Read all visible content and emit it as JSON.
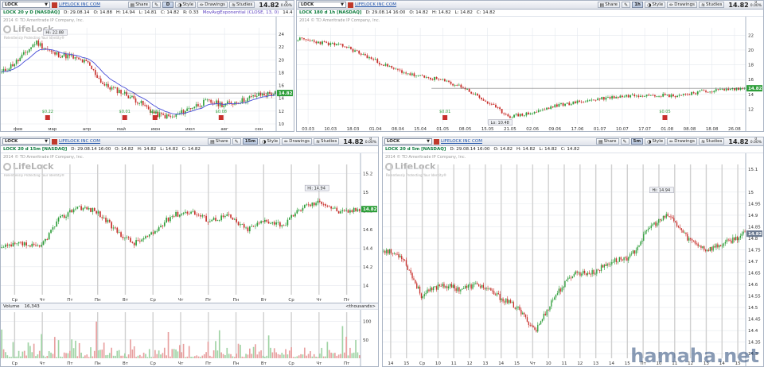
{
  "colors": {
    "up": "#2e9e3a",
    "down": "#c8302c",
    "ma": "#4a4fd8",
    "grid": "#e4e8ee",
    "session": "#d0d0d0",
    "vol": "#e8a0a0"
  },
  "watermark": "hamaha.net",
  "common": {
    "symbol": "LOCK",
    "company": "LIFELOCK INC COM",
    "share": "Share",
    "style": "Style",
    "drawings": "Drawings",
    "studies": "Studies",
    "price": "14.82",
    "change_top": "0",
    "change_bot": "0.00%",
    "copyright": "2014 © TD Ameritrade IP Company, Inc.",
    "logo_text": "LifeLock",
    "logo_tag": "Relentlessly Protecting Your Identity®"
  },
  "panes": [
    {
      "id": "tl",
      "timeframe": "D",
      "title": "LOCK 20 y D [NASDAQ]",
      "info": [
        "D: 29.08.14",
        "O: 14.88",
        "H: 14.94",
        "L: 14.81",
        "C: 14.82",
        "R: 0.33"
      ],
      "study": "MovAvgExponential (CLOSE, 13, 0)",
      "study_val": "14.4",
      "y_ticks": [
        "24",
        "22",
        "20",
        "18",
        "16",
        "14",
        "12",
        "10"
      ],
      "x_ticks": [
        "фев",
        "мар",
        "апр",
        "май",
        "июн",
        "июл",
        "авг",
        "сен"
      ],
      "price_tag": "14.82",
      "hi_label": "Hi: 22.88",
      "events": [
        "$0.22",
        "$0.01",
        "$0.01",
        "$0.08"
      ]
    },
    {
      "id": "tr",
      "timeframe": "1h",
      "title": "LOCK 180 d 1h [NASDAQ]",
      "info": [
        "D: 29.08.14 16:00",
        "O: 14.82",
        "H: 14.82",
        "L: 14.82",
        "C: 14.82"
      ],
      "y_ticks": [
        "22",
        "20",
        "18",
        "16",
        "14",
        "12"
      ],
      "x_ticks": [
        "03.03",
        "10.03",
        "18.03",
        "01.04",
        "08.04",
        "15.04",
        "01.05",
        "08.05",
        "15.05",
        "21.05",
        "02.06",
        "09.06",
        "17.06",
        "01.07",
        "10.07",
        "17.07",
        "01.08",
        "08.08",
        "18.08",
        "26.08"
      ],
      "price_tag": "14.82",
      "lo_label": "Lo: 10.48",
      "events": [
        "$0.01",
        "$0.05"
      ]
    },
    {
      "id": "bl",
      "timeframe": "15m",
      "title": "LOCK 20 d 15m [NASDAQ]",
      "info": [
        "D: 29.08.14 16:00",
        "O: 14.82",
        "H: 14.82",
        "L: 14.82",
        "C: 14.82"
      ],
      "y_ticks": [
        "15.2",
        "15",
        "14.8",
        "14.6",
        "14.4",
        "14.2",
        "14"
      ],
      "x_ticks": [
        "Ср",
        "Чт",
        "Пт",
        "Пн",
        "Вт",
        "Ср",
        "Чт",
        "Пт",
        "Пн",
        "Вт",
        "Ср",
        "Чт",
        "Пт"
      ],
      "price_tag": "14.82",
      "hi_label": "Hi: 14.94",
      "volume_label": "Volume",
      "volume_val": "16,343",
      "volume_unit": "<thousands>",
      "vol_ticks": [
        "100",
        "50"
      ]
    },
    {
      "id": "br",
      "timeframe": "5m",
      "title": "LOCK 20 d 5m [NASDAQ]",
      "info": [
        "D: 29.08.14 16:00",
        "O: 14.82",
        "H: 14.82",
        "L: 14.82",
        "C: 14.82"
      ],
      "y_ticks": [
        "15.1",
        "15",
        "14.95",
        "14.9",
        "14.85",
        "14.8",
        "14.75",
        "14.7",
        "14.65",
        "14.6",
        "14.55",
        "14.5",
        "14.45",
        "14.4",
        "14.35",
        "14.3"
      ],
      "x_ticks": [
        "14",
        "15",
        "Ср",
        "10",
        "11",
        "12",
        "13",
        "14",
        "15",
        "Чт",
        "10",
        "11",
        "12",
        "13",
        "14",
        "15",
        "Пт",
        "10",
        "11",
        "12",
        "13",
        "14",
        "15"
      ],
      "price_tag": "14.82",
      "hi_label": "Hi: 14.94"
    }
  ]
}
